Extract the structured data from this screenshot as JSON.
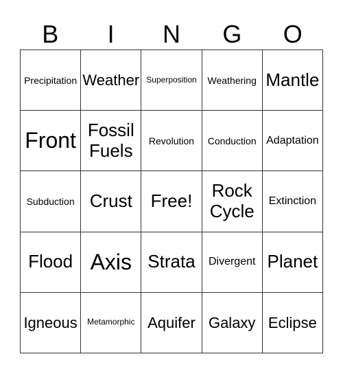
{
  "header": [
    "B",
    "I",
    "N",
    "G",
    "O"
  ],
  "rows": [
    [
      {
        "text": "Precipitation",
        "size": "s-sm"
      },
      {
        "text": "Weather",
        "size": "s-lg"
      },
      {
        "text": "Superposition",
        "size": "s-xs"
      },
      {
        "text": "Weathering",
        "size": "s-sm"
      },
      {
        "text": "Mantle",
        "size": "s-xl"
      }
    ],
    [
      {
        "text": "Front",
        "size": "s-xxl"
      },
      {
        "text": "Fossil Fuels",
        "size": "s-xl"
      },
      {
        "text": "Revolution",
        "size": "s-sm"
      },
      {
        "text": "Conduction",
        "size": "s-sm"
      },
      {
        "text": "Adaptation",
        "size": "s-md"
      }
    ],
    [
      {
        "text": "Subduction",
        "size": "s-sm"
      },
      {
        "text": "Crust",
        "size": "s-xl"
      },
      {
        "text": "Free!",
        "size": "s-xl"
      },
      {
        "text": "Rock Cycle",
        "size": "s-xl"
      },
      {
        "text": "Extinction",
        "size": "s-md"
      }
    ],
    [
      {
        "text": "Flood",
        "size": "s-xl"
      },
      {
        "text": "Axis",
        "size": "s-xxl"
      },
      {
        "text": "Strata",
        "size": "s-xl"
      },
      {
        "text": "Divergent",
        "size": "s-md"
      },
      {
        "text": "Planet",
        "size": "s-xl"
      }
    ],
    [
      {
        "text": "Igneous",
        "size": "s-lg"
      },
      {
        "text": "Metamorphic",
        "size": "s-xs"
      },
      {
        "text": "Aquifer",
        "size": "s-lg"
      },
      {
        "text": "Galaxy",
        "size": "s-lg"
      },
      {
        "text": "Eclipse",
        "size": "s-lg"
      }
    ]
  ]
}
